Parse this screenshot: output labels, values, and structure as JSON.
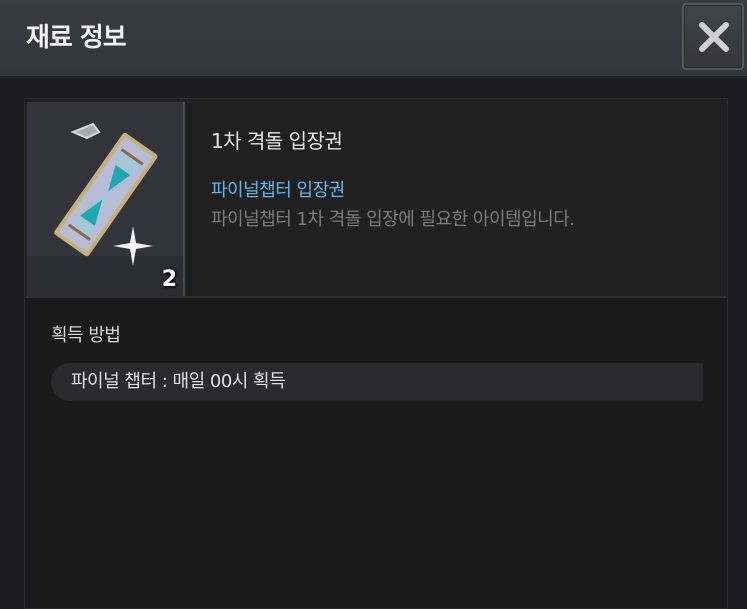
{
  "header": {
    "title": "재료 정보"
  },
  "item": {
    "name": "1차 격돌 입장권",
    "category": "파이널챕터 입장권",
    "description": "파이널챕터 1차 격돌 입장에 필요한 아이템입니다.",
    "count": "2",
    "icon": "ticket-hourglass-icon"
  },
  "acquisition": {
    "title": "획득 방법",
    "methods": [
      "파이널 챕터 : 매일 00시 획득"
    ]
  },
  "colors": {
    "category_text": "#5fb6f0",
    "header_bg": "#3b3b43",
    "panel_bg": "#1d1d1f"
  }
}
